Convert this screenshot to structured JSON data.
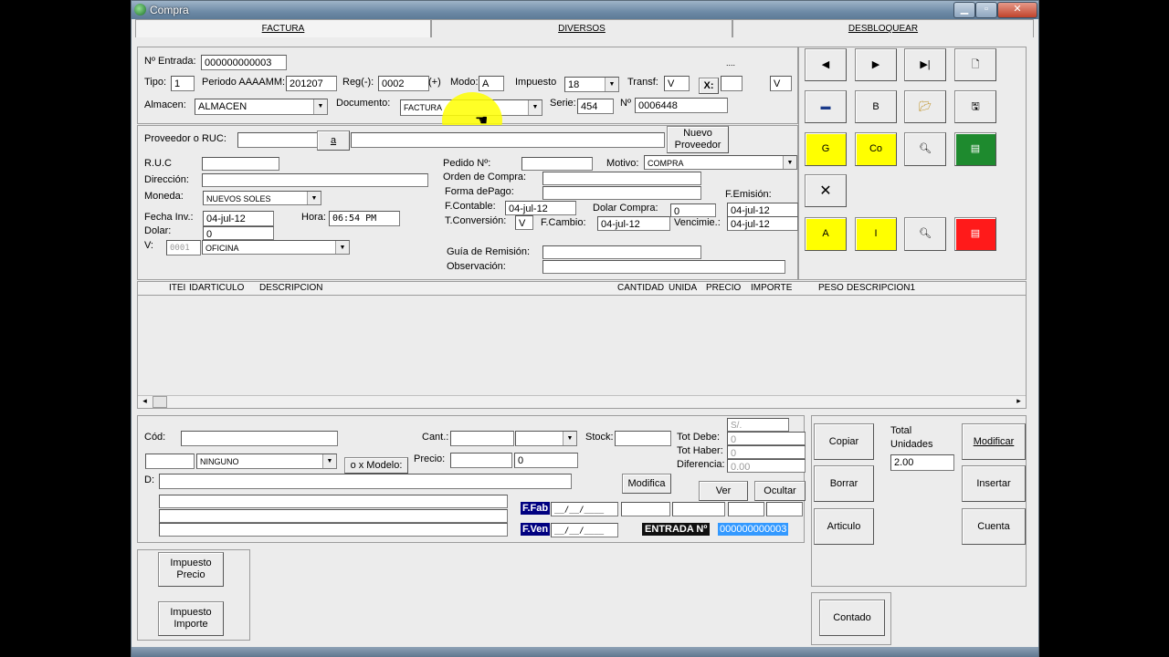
{
  "window": {
    "title": "Compra",
    "min": "▁",
    "max": "▫",
    "close": "✕"
  },
  "tabs": [
    "FACTURA",
    "DIVERSOS",
    "DESBLOQUEAR"
  ],
  "header": {
    "entrada_label": "Nº Entrada:",
    "entrada": "000000000003",
    "tipo_label": "Tipo:",
    "tipo": "1",
    "periodo_label": "Periodo AAAAMM:",
    "periodo": "201207",
    "reg_label": "Reg(-):",
    "reg": "0002",
    "reg_plus": "(+)",
    "modo_label": "Modo:",
    "modo": "A",
    "impuesto_label": "Impuesto",
    "impuesto": "18",
    "transf_label": "Transf:",
    "transf": "V",
    "x_label": "X:",
    "x_value": "V",
    "dots": "....",
    "almacen_label": "Almacen:",
    "almacen": "ALMACEN",
    "documento_label": "Documento:",
    "documento": "FACTURA",
    "serie_label": "Serie:",
    "serie": "454",
    "numero_label": "Nº",
    "numero": "0006448"
  },
  "proveedor": {
    "label": "Proveedor o RUC:",
    "a_button": "a",
    "nuevo_button": "Nuevo Proveedor",
    "ruc_label": "R.U.C",
    "direccion_label": "Dirección:",
    "moneda_label": "Moneda:",
    "moneda": "NUEVOS SOLES",
    "fecha_inv_label": "Fecha Inv.:",
    "fecha_inv": "04-jul-12",
    "hora_label": "Hora:",
    "hora": "06:54 PM",
    "dolar_label": "Dolar:",
    "dolar": "0",
    "v_label": "V:",
    "v_code": "0001",
    "v_name": "OFICINA"
  },
  "pedido": {
    "pedido_label": "Pedido Nº:",
    "motivo_label": "Motivo:",
    "motivo": "COMPRA",
    "orden_label": "Orden de Compra:",
    "forma_label": "Forma dePago:",
    "fcontable_label": "F.Contable:",
    "fcontable": "04-jul-12",
    "dolar_compra_label": "Dolar Compra:",
    "dolar_compra": "0",
    "femision_label": "F.Emisión:",
    "femision": "04-jul-12",
    "tconv_label": "T.Conversión:",
    "tconv": "V",
    "fcambio_label": "F.Cambio:",
    "fcambio": "04-jul-12",
    "venc_label": "Vencimie.:",
    "venc": "04-jul-12",
    "guia_label": "Guía de Remisión:",
    "obs_label": "Observación:"
  },
  "toolbar": {
    "b_label": "B",
    "g_label": "G",
    "co_label": "Co",
    "a_label": "A",
    "i_label": "I"
  },
  "grid": {
    "columns": [
      "ITEI",
      "IDARTICULO",
      "DESCRIPCION",
      "CANTIDAD",
      "UNIDA",
      "PRECIO",
      "IMPORTE",
      "PESO",
      "DESCRIPCION1"
    ],
    "scroll_left": "◂",
    "scroll_right": "▸"
  },
  "detail": {
    "cod_label": "Cód:",
    "cant_label": "Cant.:",
    "stock_label": "Stock:",
    "ninguno": "NINGUNO",
    "modelo_button": "o x Modelo:",
    "precio_label": "Precio:",
    "precio": "0",
    "d_label": "D:",
    "modifica_button": "Modifica",
    "tot_debe_label": "Tot Debe:",
    "tot_debe": "0",
    "tot_haber_label": "Tot Haber:",
    "tot_haber": "0",
    "diferencia_label": "Diferencia:",
    "diferencia": "0.00",
    "currency": "S/.",
    "ver_button": "Ver",
    "ocultar_button": "Ocultar",
    "ffab_label": "F.Fab",
    "ffab": "__/__/____",
    "fven_label": "F.Ven",
    "fven": "__/__/____",
    "entrada_label": "ENTRADA Nº",
    "entrada": "000000000003"
  },
  "actions": {
    "copiar": "Copiar",
    "borrar": "Borrar",
    "articulo": "Articulo",
    "total_label": "Total Unidades",
    "total": "2.00",
    "modificar": "Modificar",
    "insertar": "Insertar",
    "cuenta": "Cuenta",
    "contado": "Contado",
    "impuesto_precio": "Impuesto Precio",
    "impuesto_importe": "Impuesto Importe"
  }
}
